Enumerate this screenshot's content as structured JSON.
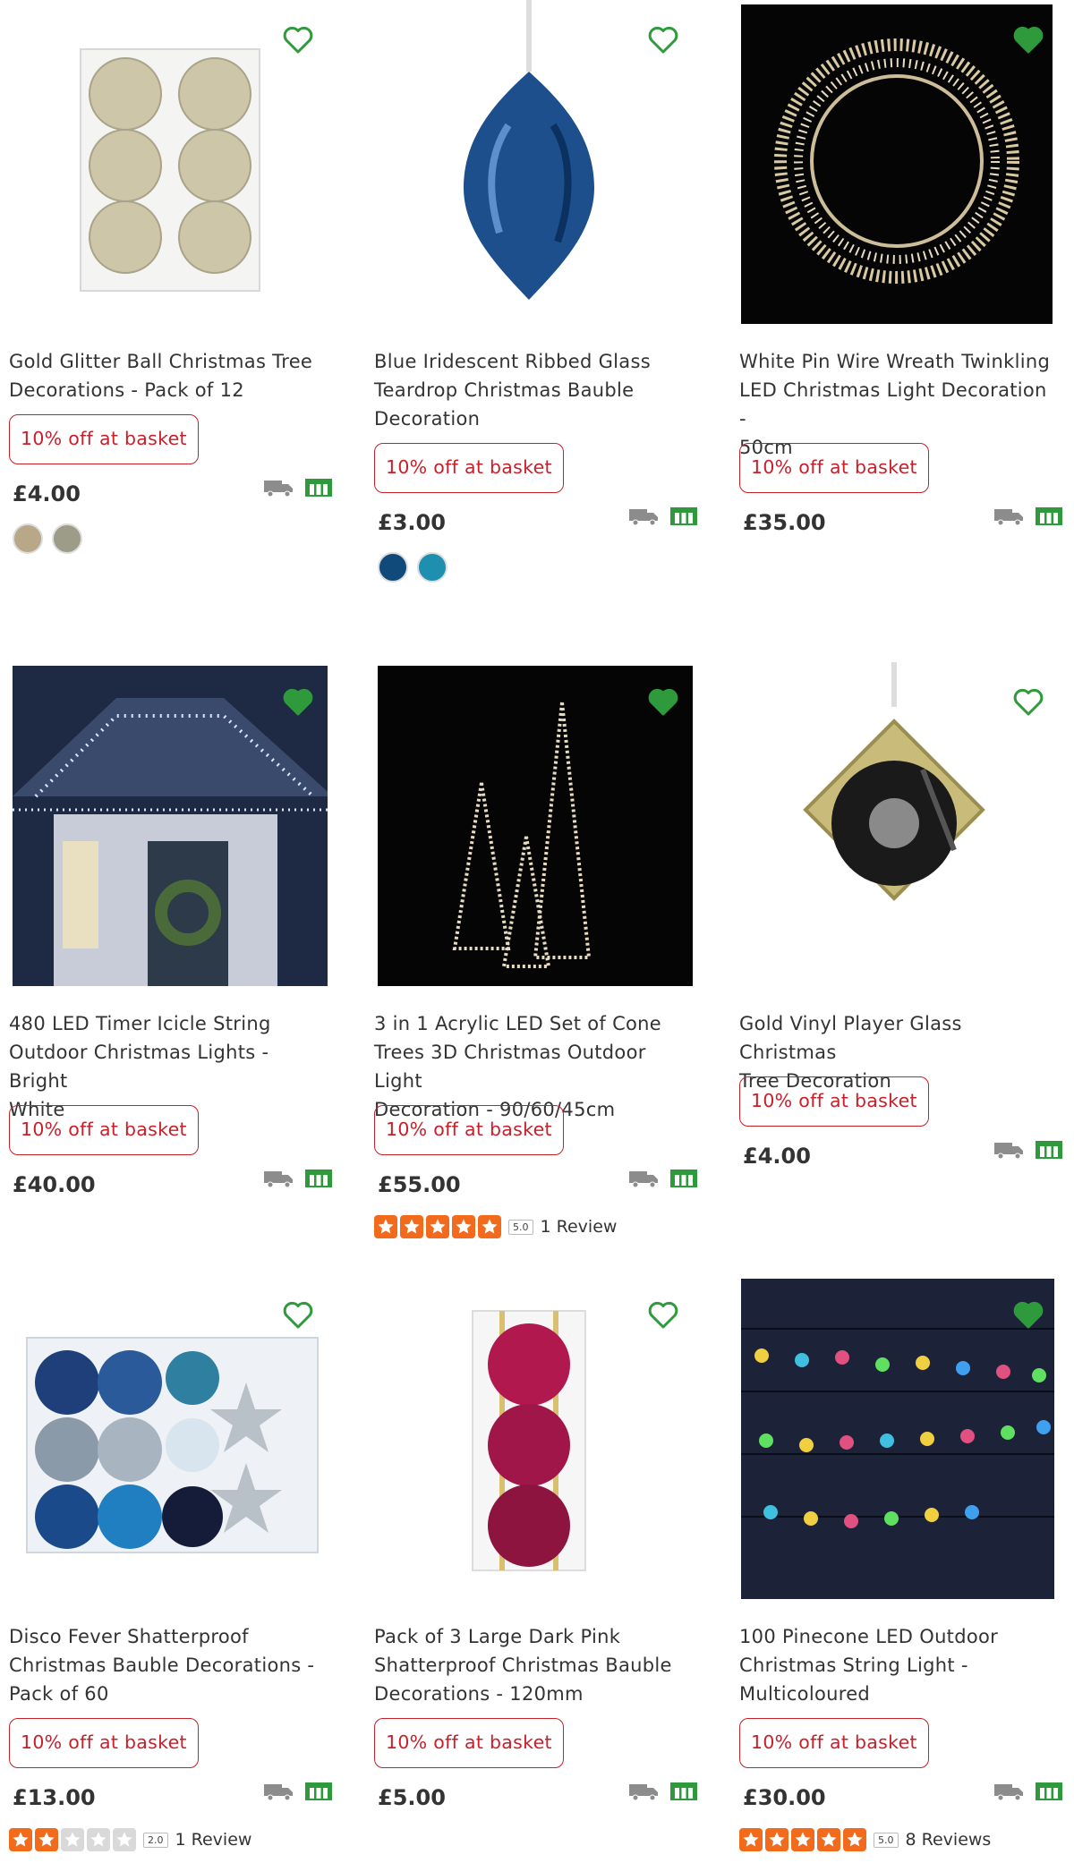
{
  "colors": {
    "promo": "#c8202a",
    "heart": "#2e9a3b",
    "star_filled": "#f26a1b",
    "star_empty": "#d9d9d9",
    "delivery_icon": "#8c8c8c",
    "collect_icon": "#2e9a3b"
  },
  "icons": {
    "favourite": "heart-outline-icon",
    "delivery": "delivery-van-icon",
    "collect": "click-and-collect-icon",
    "star": "star-icon"
  },
  "products": [
    {
      "title_lines": [
        "Gold Glitter Ball Christmas Tree",
        "Decorations - Pack of 12"
      ],
      "promo": "10% off at basket",
      "price": "£4.00",
      "swatches": [
        "#b8a888",
        "#9c9c88"
      ]
    },
    {
      "title_lines": [
        "Blue Iridescent Ribbed Glass",
        "Teardrop Christmas Bauble",
        "Decoration"
      ],
      "promo": "10% off at basket",
      "price": "£3.00",
      "swatches": [
        "#0f4a7a",
        "#1f8fb0"
      ]
    },
    {
      "title_lines": [
        "White Pin Wire Wreath Twinkling",
        "LED Christmas Light Decoration -",
        "50cm"
      ],
      "promo": "10% off at basket",
      "price": "£35.00"
    },
    {
      "title_lines": [
        "480 LED Timer Icicle String",
        "Outdoor Christmas Lights - Bright",
        "White"
      ],
      "promo": "10% off at basket",
      "price": "£40.00"
    },
    {
      "title_lines": [
        "3 in 1 Acrylic LED Set of Cone",
        "Trees 3D Christmas Outdoor Light",
        "Decoration - 90/60/45cm"
      ],
      "promo": "10% off at basket",
      "price": "£55.00",
      "rating": {
        "stars": 5,
        "score": "5.0",
        "reviews": "1 Review"
      }
    },
    {
      "title_lines": [
        "Gold Vinyl Player Glass Christmas",
        "Tree Decoration"
      ],
      "promo": "10% off at basket",
      "price": "£4.00"
    },
    {
      "title_lines": [
        "Disco Fever Shatterproof",
        "Christmas Bauble Decorations -",
        "Pack of 60"
      ],
      "promo": "10% off at basket",
      "price": "£13.00",
      "rating": {
        "stars": 2,
        "score": "2.0",
        "reviews": "1 Review"
      }
    },
    {
      "title_lines": [
        "Pack of 3 Large Dark Pink",
        "Shatterproof Christmas Bauble",
        "Decorations - 120mm"
      ],
      "promo": "10% off at basket",
      "price": "£5.00"
    },
    {
      "title_lines": [
        "100 Pinecone LED Outdoor",
        "Christmas String Light -",
        "Multicoloured"
      ],
      "promo": "10% off at basket",
      "price": "£30.00",
      "rating": {
        "stars": 5,
        "score": "5.0",
        "reviews": "8 Reviews"
      }
    }
  ]
}
